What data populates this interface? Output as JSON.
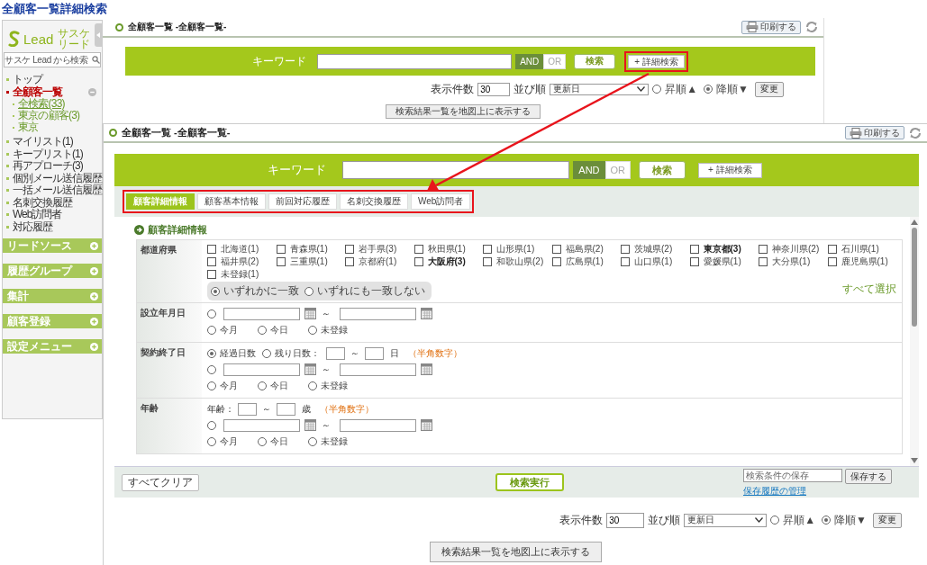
{
  "page_title": "全顧客一覧詳細検索",
  "sidebar": {
    "logo": "Lead",
    "logo_sub": [
      "サスケ",
      "リード"
    ],
    "search_placeholder": "サスケ Lead から検索",
    "items": [
      {
        "text": "トップ",
        "selected": false
      },
      {
        "text": "全顧客一覧",
        "selected": true,
        "expanded": true,
        "children": [
          {
            "text": "全検索(33)",
            "selected": true
          },
          {
            "text": "東京の顧客(3)",
            "selected": false
          },
          {
            "text": "東京",
            "selected": false
          }
        ]
      },
      {
        "text": "マイリスト(1)",
        "selected": false
      },
      {
        "text": "キープリスト(1)",
        "selected": false
      },
      {
        "text": "再アプローチ(3)",
        "selected": false
      },
      {
        "text": "個別メール送信履歴",
        "selected": false
      },
      {
        "text": "一括メール送信履歴",
        "selected": false
      },
      {
        "text": "名刺交換履歴",
        "selected": false
      },
      {
        "text": "Web訪問者",
        "selected": false
      },
      {
        "text": "対応履歴",
        "selected": false
      }
    ],
    "sections": [
      "リードソース",
      "履歴グループ",
      "集計",
      "顧客登録",
      "設定メニュー"
    ]
  },
  "windows": [
    {
      "title": "全顧客一覧 -全顧客一覧-",
      "print": "印刷する",
      "search": {
        "label": "キーワード",
        "and": {
          "text": "AND",
          "selected": true
        },
        "or": {
          "text": "OR",
          "selected": false
        },
        "submit": "検索",
        "advanced": "+ 詳細検索",
        "advanced_highlighted": true
      },
      "list_options": {
        "count_label": "表示件数",
        "count": "30",
        "sort_label": "並び順",
        "sort": "更新日",
        "orders": [
          {
            "text": "昇順▲",
            "selected": false
          },
          {
            "text": "降順▼",
            "selected": true
          }
        ],
        "apply": "変更"
      },
      "map_button": "検索結果一覧を地図上に表示する"
    },
    {
      "title": "全顧客一覧 -全顧客一覧-",
      "print": "印刷する",
      "search": {
        "label": "キーワード",
        "and": {
          "text": "AND",
          "selected": true
        },
        "or": {
          "text": "OR",
          "selected": false
        },
        "submit": "検索",
        "advanced": "+ 詳細検索"
      },
      "tabs_highlighted": true,
      "tabs": [
        {
          "label": "顧客詳細情報",
          "selected": true
        },
        {
          "label": "顧客基本情報",
          "selected": false
        },
        {
          "label": "前回対応履歴",
          "selected": false
        },
        {
          "label": "名刺交換履歴",
          "selected": false
        },
        {
          "label": "Web訪問者",
          "selected": false
        }
      ],
      "form": {
        "heading": "顧客詳細情報",
        "prefectures": {
          "label": "都道府県",
          "options": [
            {
              "text": "北海道(1)",
              "checked": false,
              "bold": false
            },
            {
              "text": "青森県(1)",
              "checked": false,
              "bold": false
            },
            {
              "text": "岩手県(3)",
              "checked": false,
              "bold": false
            },
            {
              "text": "秋田県(1)",
              "checked": false,
              "bold": false
            },
            {
              "text": "山形県(1)",
              "checked": false,
              "bold": false
            },
            {
              "text": "福島県(2)",
              "checked": false,
              "bold": false
            },
            {
              "text": "茨城県(2)",
              "checked": false,
              "bold": false
            },
            {
              "text": "東京都(3)",
              "checked": false,
              "bold": true
            },
            {
              "text": "神奈川県(2)",
              "checked": false,
              "bold": false
            },
            {
              "text": "石川県(1)",
              "checked": false,
              "bold": false
            },
            {
              "text": "福井県(2)",
              "checked": false,
              "bold": false
            },
            {
              "text": "三重県(1)",
              "checked": false,
              "bold": false
            },
            {
              "text": "京都府(1)",
              "checked": false,
              "bold": false
            },
            {
              "text": "大阪府(3)",
              "checked": false,
              "bold": true
            },
            {
              "text": "和歌山県(2)",
              "checked": false,
              "bold": false
            },
            {
              "text": "広島県(1)",
              "checked": false,
              "bold": false
            },
            {
              "text": "山口県(1)",
              "checked": false,
              "bold": false
            },
            {
              "text": "愛媛県(1)",
              "checked": false,
              "bold": false
            },
            {
              "text": "大分県(1)",
              "checked": false,
              "bold": false
            },
            {
              "text": "鹿児島県(1)",
              "checked": false,
              "bold": false
            },
            {
              "text": "未登録(1)",
              "checked": false,
              "bold": false
            }
          ],
          "match": [
            {
              "text": "いずれかに一致",
              "selected": true
            },
            {
              "text": "いずれにも一致しない",
              "selected": false
            }
          ],
          "select_all": "すべて選択"
        },
        "rows": [
          {
            "label": "設立年月日",
            "lines": [
              {
                "kind": "date_range",
                "selected": false,
                "tilde": "～"
              },
              {
                "kind": "radios",
                "options": [
                  {
                    "text": "今月",
                    "selected": false
                  },
                  {
                    "text": "今日",
                    "selected": false
                  },
                  {
                    "text": "未登録",
                    "selected": false
                  }
                ]
              }
            ]
          },
          {
            "label": "契約終了日",
            "lines": [
              {
                "kind": "number_range",
                "options": [
                  {
                    "text": "経過日数",
                    "selected": true
                  },
                  {
                    "text": "残り日数：",
                    "selected": false
                  }
                ],
                "tilde": "～",
                "unit": "日",
                "note": "（半角数字）"
              },
              {
                "kind": "date_range",
                "selected": false,
                "tilde": "～"
              },
              {
                "kind": "radios",
                "options": [
                  {
                    "text": "今月",
                    "selected": false
                  },
                  {
                    "text": "今日",
                    "selected": false
                  },
                  {
                    "text": "未登録",
                    "selected": false
                  }
                ]
              }
            ]
          },
          {
            "label": "年齢",
            "lines": [
              {
                "kind": "number_range",
                "prefix": "年齢：",
                "tilde": "～",
                "unit": "歳",
                "note": "（半角数字）"
              },
              {
                "kind": "date_range",
                "selected": false,
                "tilde": "～"
              },
              {
                "kind": "radios",
                "options": [
                  {
                    "text": "今月",
                    "selected": false
                  },
                  {
                    "text": "今日",
                    "selected": false
                  },
                  {
                    "text": "未登録",
                    "selected": false
                  }
                ]
              }
            ]
          }
        ]
      },
      "footer": {
        "clear": "すべてクリア",
        "execute": "検索実行",
        "save_placeholder": "検索条件の保存",
        "save": "保存する",
        "history_link": "保存履歴の管理"
      },
      "list_options": {
        "count_label": "表示件数",
        "count": "30",
        "sort_label": "並び順",
        "sort": "更新日",
        "orders": [
          {
            "text": "昇順▲",
            "selected": false
          },
          {
            "text": "降順▼",
            "selected": true
          }
        ],
        "apply": "変更"
      },
      "map_button": "検索結果一覧を地図上に表示する"
    }
  ]
}
